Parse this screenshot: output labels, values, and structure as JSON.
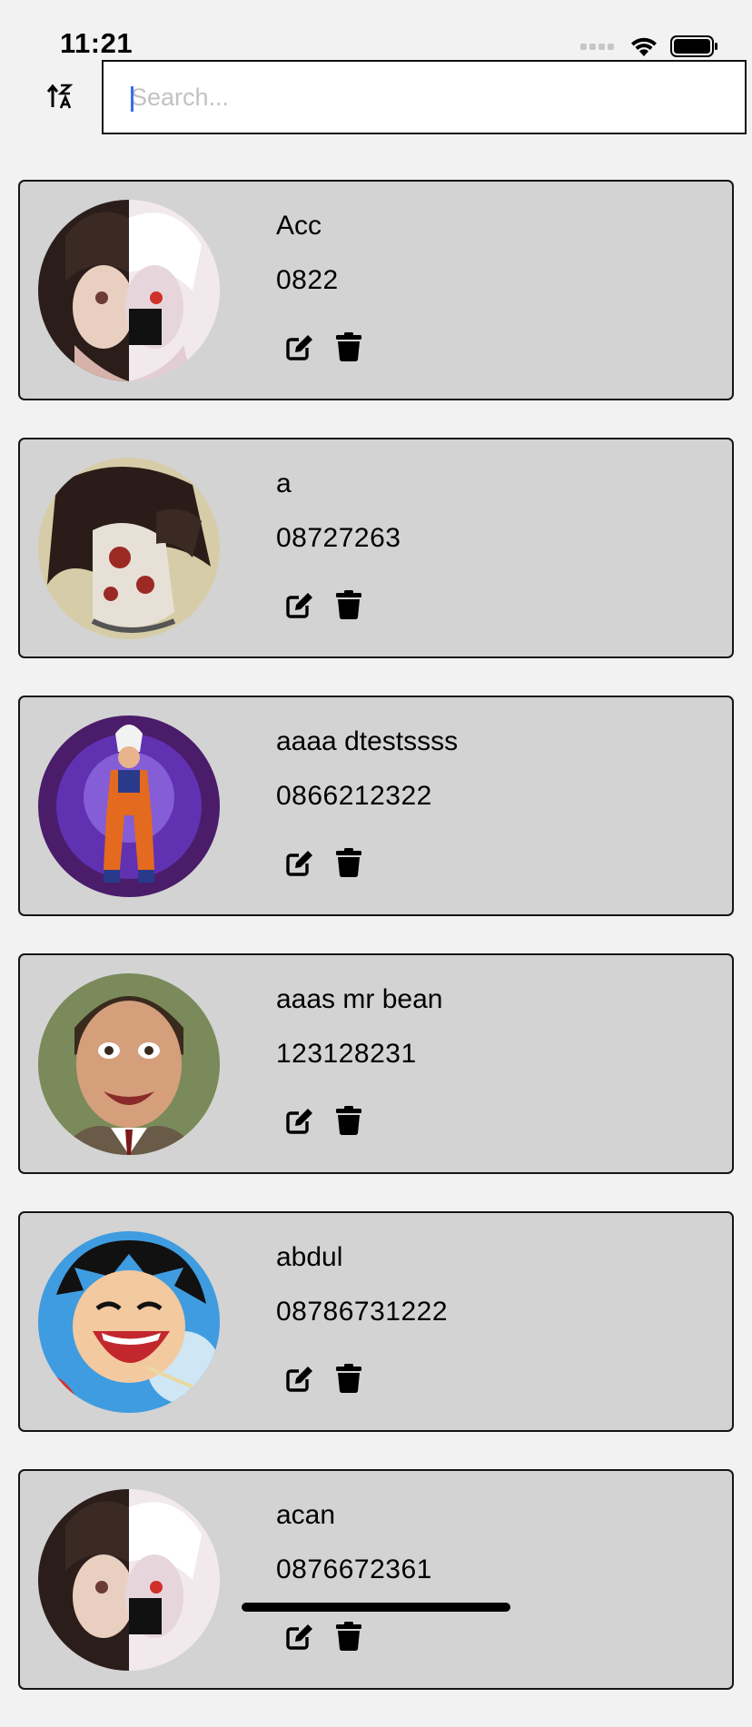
{
  "status": {
    "time": "11:21"
  },
  "search": {
    "placeholder": "Search..."
  },
  "icons": {
    "sort": "sort-alpha-icon",
    "edit": "edit-icon",
    "delete": "trash-icon"
  },
  "contacts": [
    {
      "name": "Acc",
      "phone": "0822",
      "avatar": "avatar-ghoul-mask"
    },
    {
      "name": "a",
      "phone": "08727263",
      "avatar": "avatar-ghoul-tattoo"
    },
    {
      "name": "aaaa dtestssss",
      "phone": "0866212322",
      "avatar": "avatar-warrior-aura"
    },
    {
      "name": "aaas mr bean",
      "phone": "123128231",
      "avatar": "avatar-man-portrait"
    },
    {
      "name": "abdul",
      "phone": "08786731222",
      "avatar": "avatar-pirate-laugh"
    },
    {
      "name": "acan",
      "phone": "0876672361",
      "avatar": "avatar-ghoul-mask"
    }
  ]
}
